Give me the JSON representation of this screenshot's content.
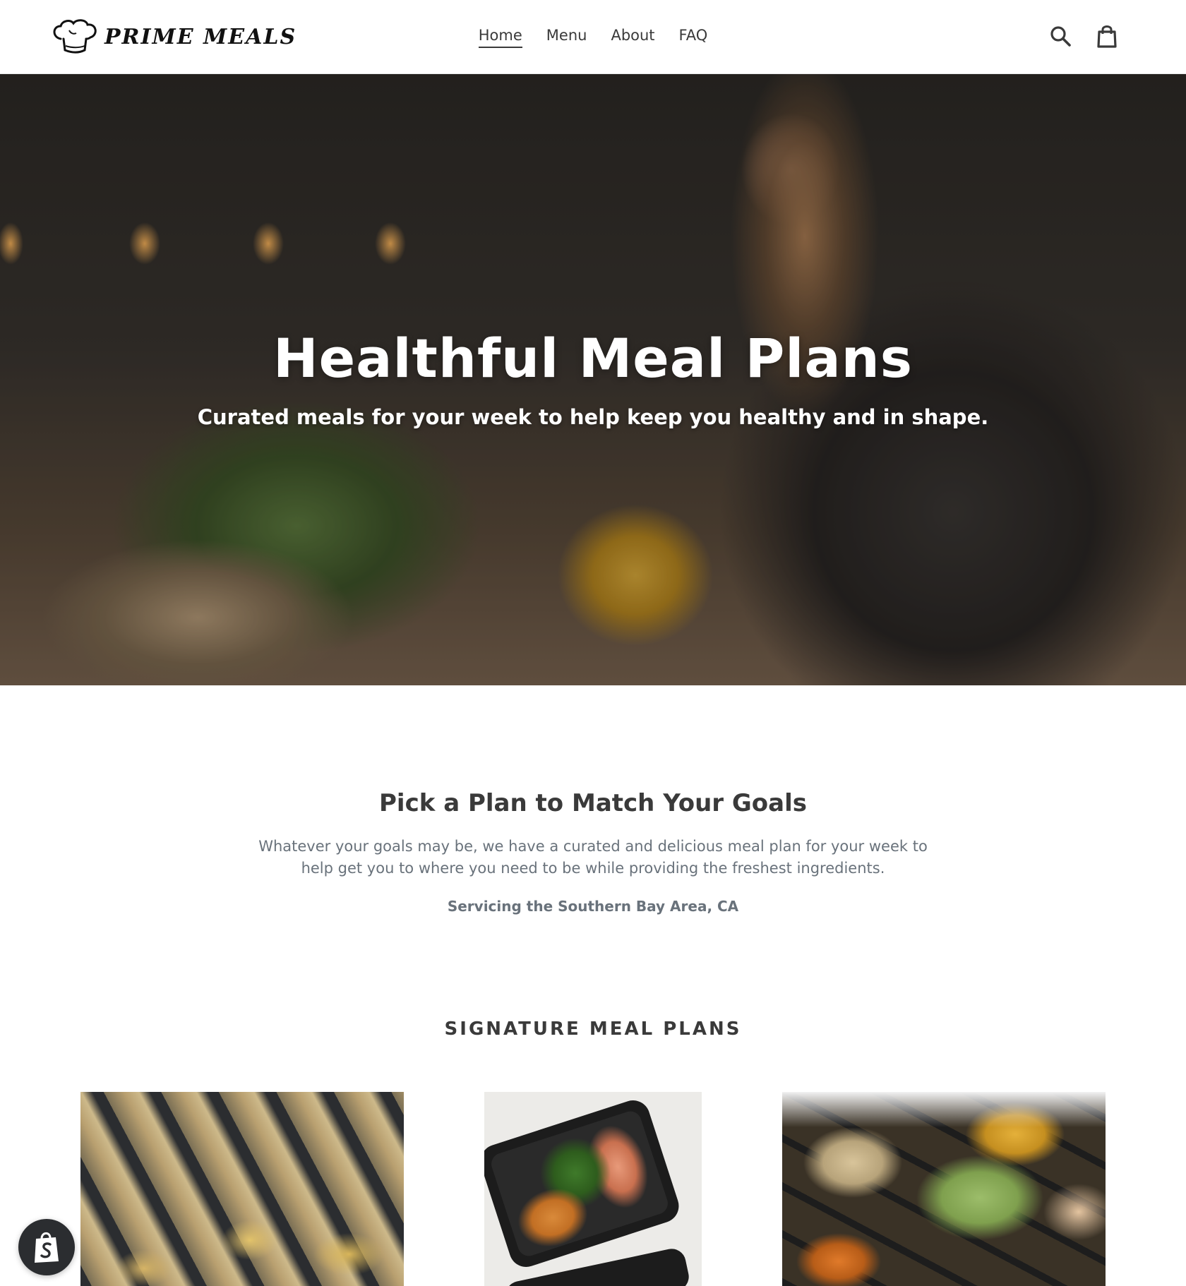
{
  "brand": {
    "name": "PRIME MEALS"
  },
  "nav": {
    "items": [
      {
        "label": "Home",
        "active": true
      },
      {
        "label": "Menu",
        "active": false
      },
      {
        "label": "About",
        "active": false
      },
      {
        "label": "FAQ",
        "active": false
      }
    ]
  },
  "header_icons": {
    "search": "search-icon",
    "cart": "cart-icon"
  },
  "hero": {
    "title": "Healthful Meal Plans",
    "subtitle": "Curated meals for your week to help keep you healthy and in shape."
  },
  "intro": {
    "heading": "Pick a Plan to Match Your Goals",
    "description": "Whatever your goals may be, we have a curated and delicious meal plan for your week to help get you to where you need to be while providing the freshest ingredients.",
    "service_area": "Servicing the Southern Bay Area, CA"
  },
  "plans_section": {
    "title": "SIGNATURE MEAL PLANS"
  },
  "colors": {
    "text": "#3a3a3a",
    "muted": "#69727b",
    "badge": "#2b2d30"
  },
  "badge": {
    "icon": "shopify-bag-icon"
  }
}
